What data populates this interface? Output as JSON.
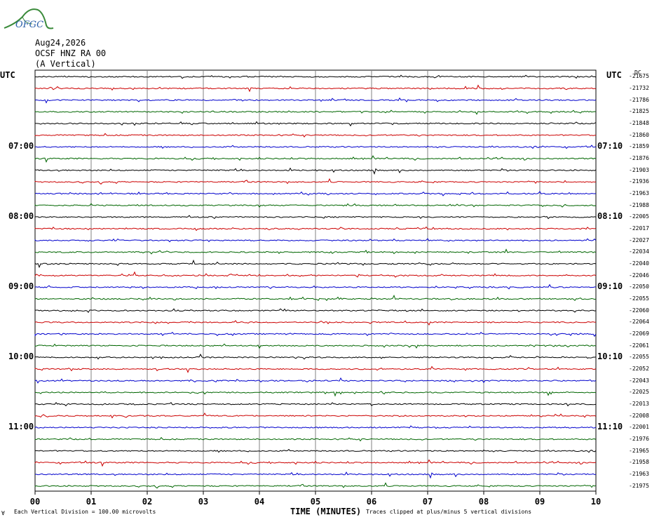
{
  "logo": {
    "text": "OFGC",
    "color": "#3a8a3a",
    "text_color": "#2a5fa8"
  },
  "header": {
    "date": "Aug24,2026",
    "station": "OCSF HNZ RA 00",
    "component": "(A Vertical)"
  },
  "utc_left": "UTC",
  "utc_right": "UTC",
  "chart_data": {
    "type": "line",
    "title": "OCSF HNZ RA 00 (A Vertical)",
    "xlabel": "TIME (MINUTES)",
    "x_ticks": [
      "00",
      "01",
      "02",
      "03",
      "04",
      "05",
      "06",
      "07",
      "08",
      "09",
      "10"
    ],
    "xlim": [
      0,
      10
    ],
    "left_time_labels": [
      {
        "label": "07:00",
        "row": 6
      },
      {
        "label": "08:00",
        "row": 12
      },
      {
        "label": "09:00",
        "row": 18
      },
      {
        "label": "10:00",
        "row": 24
      },
      {
        "label": "11:00",
        "row": 30
      }
    ],
    "right_time_labels": [
      {
        "label": "07:10",
        "row": 6
      },
      {
        "label": "08:10",
        "row": 12
      },
      {
        "label": "09:10",
        "row": 18
      },
      {
        "label": "10:10",
        "row": 24
      },
      {
        "label": "11:10",
        "row": 30
      }
    ],
    "row_colors": [
      "#000000",
      "#cc0000",
      "#0000cc",
      "#006600"
    ],
    "trace_values": [
      "-21675",
      "-21732",
      "-21786",
      "-21825",
      "-21848",
      "-21860",
      "-21859",
      "-21876",
      "-21903",
      "-21936",
      "-21963",
      "-21988",
      "-22005",
      "-22017",
      "-22027",
      "-22034",
      "-22040",
      "-22046",
      "-22050",
      "-22055",
      "-22060",
      "-22064",
      "-22069",
      "-22061",
      "-22055",
      "-22052",
      "-22043",
      "-22025",
      "-22013",
      "-22008",
      "-22001",
      "-21976",
      "-21965",
      "-21958",
      "-21963",
      "-21975"
    ],
    "top_value_prefix": "DC",
    "grid": true
  },
  "footer": {
    "scale_note": "Each Vertical Division =  100.00 microvolts",
    "clip_note": "Traces clipped at plus/minus 5 vertical divisions",
    "corner_mark": "∀"
  }
}
